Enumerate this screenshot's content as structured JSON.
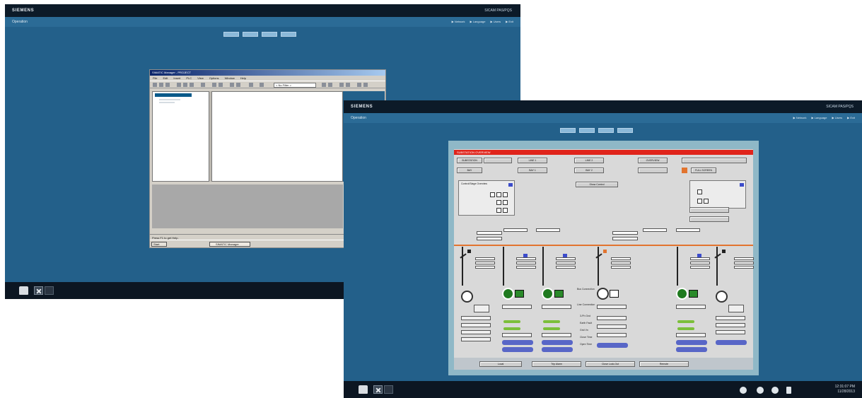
{
  "screen1": {
    "brand": "SIEMENS",
    "product": "SICAM PAS/PQS",
    "breadcrumb": "Operation",
    "header_links": [
      "▶ Network",
      "▶ Language",
      "▶ Users",
      "▶ Exit"
    ],
    "window": {
      "title": "SIMATIC Manager - PROJECT",
      "menu": [
        "File",
        "Edit",
        "Insert",
        "PLC",
        "View",
        "Options",
        "Window",
        "Help"
      ],
      "filter_select": "< No Filter >",
      "status_text": "Press F1 to get Help.",
      "start_label": "Start",
      "task_label": "SIMATIC Manager"
    },
    "taskbar_icons": [
      "folder-icon",
      "tools-icon",
      "window-icon"
    ]
  },
  "screen2": {
    "brand": "SIEMENS",
    "product": "SICAM PAS/PQS",
    "breadcrumb": "Operation",
    "header_links": [
      "▶ Network",
      "▶ Language",
      "▶ Users",
      "▶ Exit"
    ],
    "hmi": {
      "header_title": "SUBSTATION OVERVIEW",
      "top_buttons": [
        "SUBSTATION",
        "LINE 1",
        "LINE 2",
        "OVERVIEW",
        "BAY",
        "BAY 1",
        "BAY 2",
        "FULL SCREEN"
      ],
      "panel_title": "Control/Stage Overview",
      "center_button": "Show Control",
      "mid_labels": [
        "Bus Connection",
        "Line Connection",
        "3-Ph Gnd",
        "Earth Fault",
        "Grid Vn",
        "Close Time",
        "Open Time"
      ],
      "bottom_buttons": [
        "Local",
        "Trip Alarm",
        "Close Lock-Out",
        "Remote"
      ]
    },
    "taskbar_icons": [
      "folder-icon",
      "tools-icon",
      "window-icon"
    ],
    "status_icons": [
      "user-icon",
      "network-icon",
      "globe-icon",
      "sound-icon"
    ],
    "clock": {
      "time": "12:31:07 PM",
      "date": "11/28/2013"
    }
  }
}
